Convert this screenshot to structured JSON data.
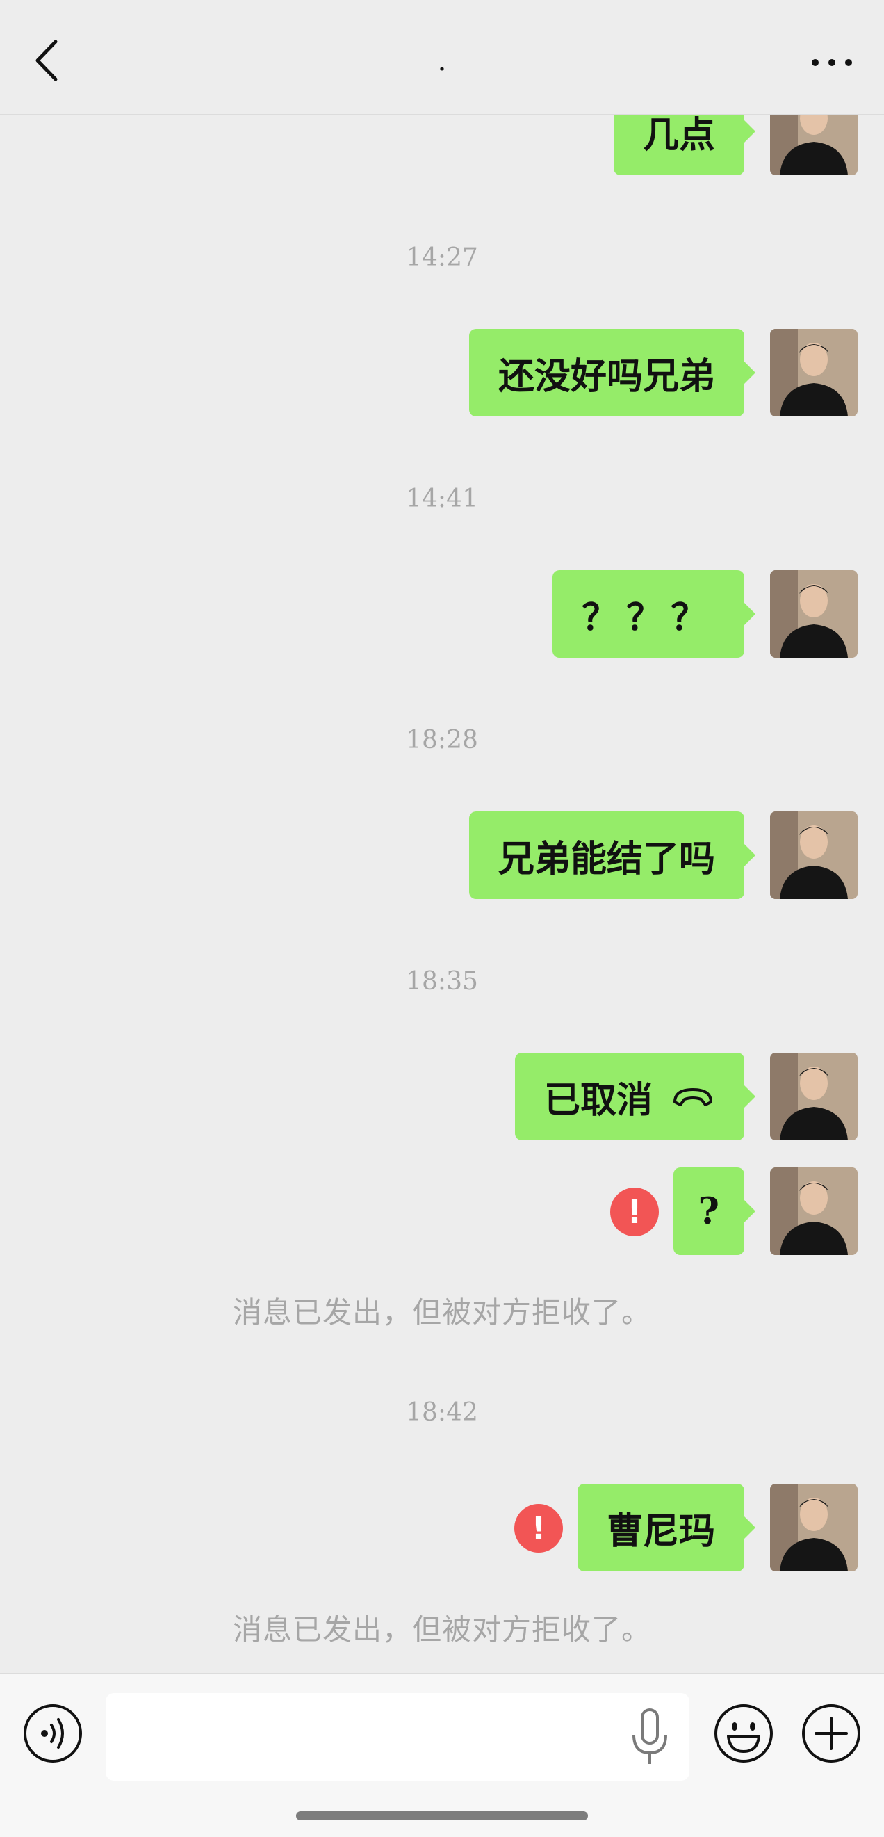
{
  "header": {
    "title": "."
  },
  "messages": [
    {
      "text": "几点",
      "avatar": "user-avatar"
    },
    {
      "text": "还没好吗兄弟",
      "avatar": "user-avatar"
    },
    {
      "text": "？？？",
      "avatar": "user-avatar"
    },
    {
      "text": "兄弟能结了吗",
      "avatar": "user-avatar"
    },
    {
      "text": "已取消",
      "icon": "phone-hangup-icon"
    },
    {
      "text": "?",
      "status": "rejected"
    },
    {
      "text": "曹尼玛",
      "status": "rejected"
    }
  ],
  "timestamps": [
    "14:27",
    "14:41",
    "18:28",
    "18:35",
    "18:42"
  ],
  "notices": [
    "消息已发出，但被对方拒收了。",
    "消息已发出，但被对方拒收了。"
  ],
  "error_symbol": "!",
  "colors": {
    "bubble": "#95ec69",
    "background": "#ededed",
    "error": "#f25555"
  },
  "input_bar": {
    "icons": [
      "voice-icon",
      "mic-icon",
      "emoji-icon",
      "plus-icon"
    ]
  }
}
